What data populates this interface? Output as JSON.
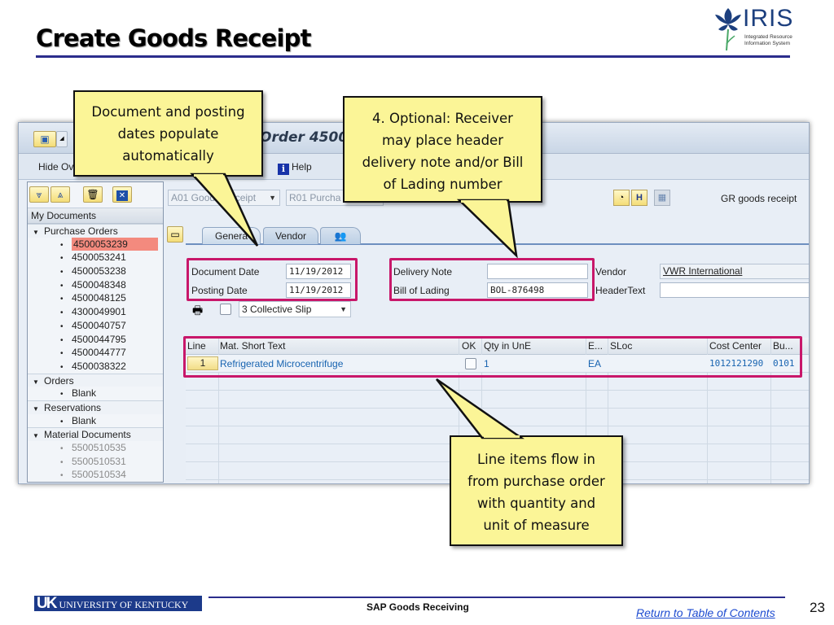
{
  "slide": {
    "title": "Create Goods Receipt",
    "logo": {
      "name": "IRIS",
      "subtitle_line1": "Integrated Resource",
      "subtitle_line2": "Information System"
    }
  },
  "sap": {
    "window_title": "Order 4500",
    "appbar": {
      "hide_overview": "Hide Ov",
      "help": "Help"
    },
    "tree": {
      "header": "My Documents",
      "groups": [
        {
          "label": "Purchase Orders",
          "items": [
            "4500053239",
            "4500053241",
            "4500053238",
            "4500048348",
            "4500048125",
            "4300049901",
            "4500040757",
            "4500044795",
            "4500044777",
            "4500038322"
          ],
          "selected_index": 0
        },
        {
          "label": "Orders",
          "items": [
            "Blank"
          ]
        },
        {
          "label": "Reservations",
          "items": [
            "Blank"
          ]
        },
        {
          "label": "Material Documents",
          "items": [
            "5500510535",
            "5500510531",
            "5500510534"
          ],
          "dimmed": true
        }
      ]
    },
    "transaction": {
      "action_combo": "A01 Goods Receipt",
      "action_combo_visible": "A01 Go",
      "action_combo_visible2": "eipt",
      "reference_combo": "R01 Purcha",
      "movement_text": "GR goods receipt"
    },
    "tabs": [
      "General",
      "Vendor",
      "people-icon"
    ],
    "tabs_visible": {
      "general": "Genera",
      "vendor": "Vendor"
    },
    "header_fields": {
      "document_date_label": "Document Date",
      "document_date": "11/19/2012",
      "posting_date_label": "Posting Date",
      "posting_date": "11/19/2012",
      "slip_option": "3 Collective Slip",
      "delivery_note_label": "Delivery Note",
      "delivery_note": "",
      "bill_of_lading_label": "Bill of Lading",
      "bill_of_lading": "BOL-876498",
      "vendor_label": "Vendor",
      "vendor": "VWR International",
      "header_text_label": "HeaderText",
      "header_text": ""
    },
    "items_table": {
      "columns": [
        "Line",
        "Mat. Short Text",
        "OK",
        "Qty in UnE",
        "E...",
        "SLoc",
        "Cost Center",
        "Bu..."
      ],
      "rows": [
        {
          "line": "1",
          "mat_short_text": "Refrigerated Microcentrifuge",
          "ok": false,
          "qty": "1",
          "unit": "EA",
          "sloc": "",
          "cost_center": "1012121290",
          "bu": "0101"
        }
      ]
    }
  },
  "callouts": {
    "dates": "Document and posting dates populate automatically",
    "dates_lines": [
      "Document and posting",
      "dates populate",
      "automatically"
    ],
    "optional": "4. Optional: Receiver may place header delivery note and/or Bill of Lading number",
    "optional_lines": [
      "4. Optional: Receiver",
      "may place header",
      "delivery note and/or Bill",
      "of Lading number"
    ],
    "line_items": "Line items flow in from purchase order with quantity and unit of measure",
    "line_items_lines": [
      "Line items flow in",
      "from purchase order",
      "with quantity and",
      "unit of measure"
    ]
  },
  "footer": {
    "university": "UNIVERSITY OF KENTUCKY",
    "uk_mark": "UK",
    "course": "SAP Goods Receiving",
    "toc_link": "Return to Table of Contents",
    "page_number": "23"
  },
  "colors": {
    "highlight": "#c8176a",
    "callout_fill": "#fbf597",
    "rule": "#2b2d8c",
    "selected_row": "#f38a7e",
    "link_blue": "#1763b0"
  }
}
